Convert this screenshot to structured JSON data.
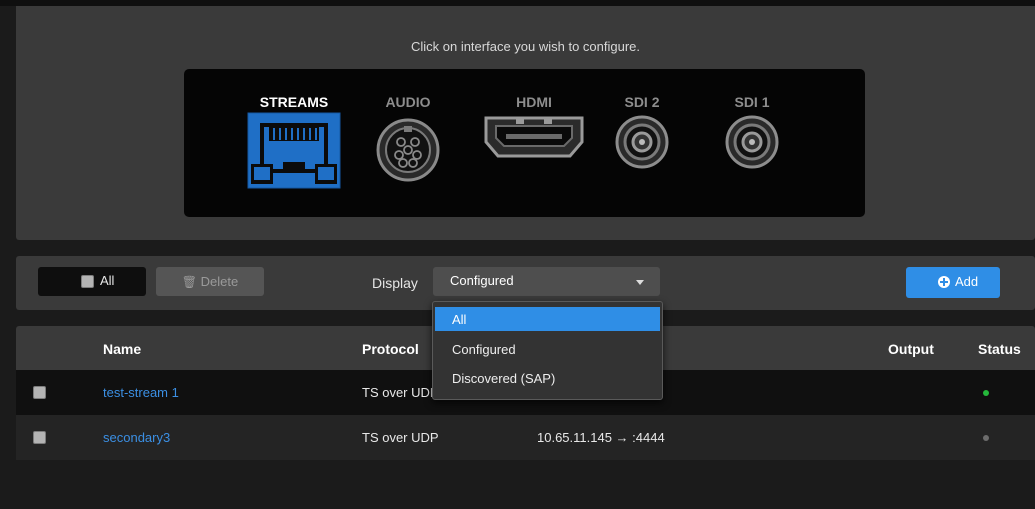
{
  "config": {
    "instruction": "Click on interface you wish to configure.",
    "interfaces": [
      {
        "label": "STREAMS",
        "selected": true,
        "icon": "ethernet-port-icon"
      },
      {
        "label": "AUDIO",
        "selected": false,
        "icon": "audio-connector-icon"
      },
      {
        "label": "HDMI",
        "selected": false,
        "icon": "hdmi-port-icon"
      },
      {
        "label": "SDI 2",
        "selected": false,
        "icon": "bnc-connector-icon"
      },
      {
        "label": "SDI 1",
        "selected": false,
        "icon": "bnc-connector-icon"
      }
    ]
  },
  "toolbar": {
    "all_label": "All",
    "delete_label": "Delete",
    "display_label": "Display",
    "display_value": "Configured",
    "add_label": "Add"
  },
  "dropdown": {
    "options": [
      "All",
      "Configured",
      "Discovered (SAP)"
    ],
    "highlighted": "All"
  },
  "table": {
    "headers": {
      "name": "Name",
      "protocol": "Protocol",
      "output": "Output",
      "status": "Status"
    },
    "rows": [
      {
        "name": "test-stream 1",
        "protocol": "TS over UDP",
        "address": "",
        "status_color": "#25b83b"
      },
      {
        "name": "secondary3",
        "protocol": "TS over UDP",
        "address": "10.65.11.145 → :4444",
        "status_color": "#6c6c6c"
      }
    ]
  },
  "colors": {
    "accent": "#2f8ee6",
    "selected_interface": "#1f6fc6"
  }
}
